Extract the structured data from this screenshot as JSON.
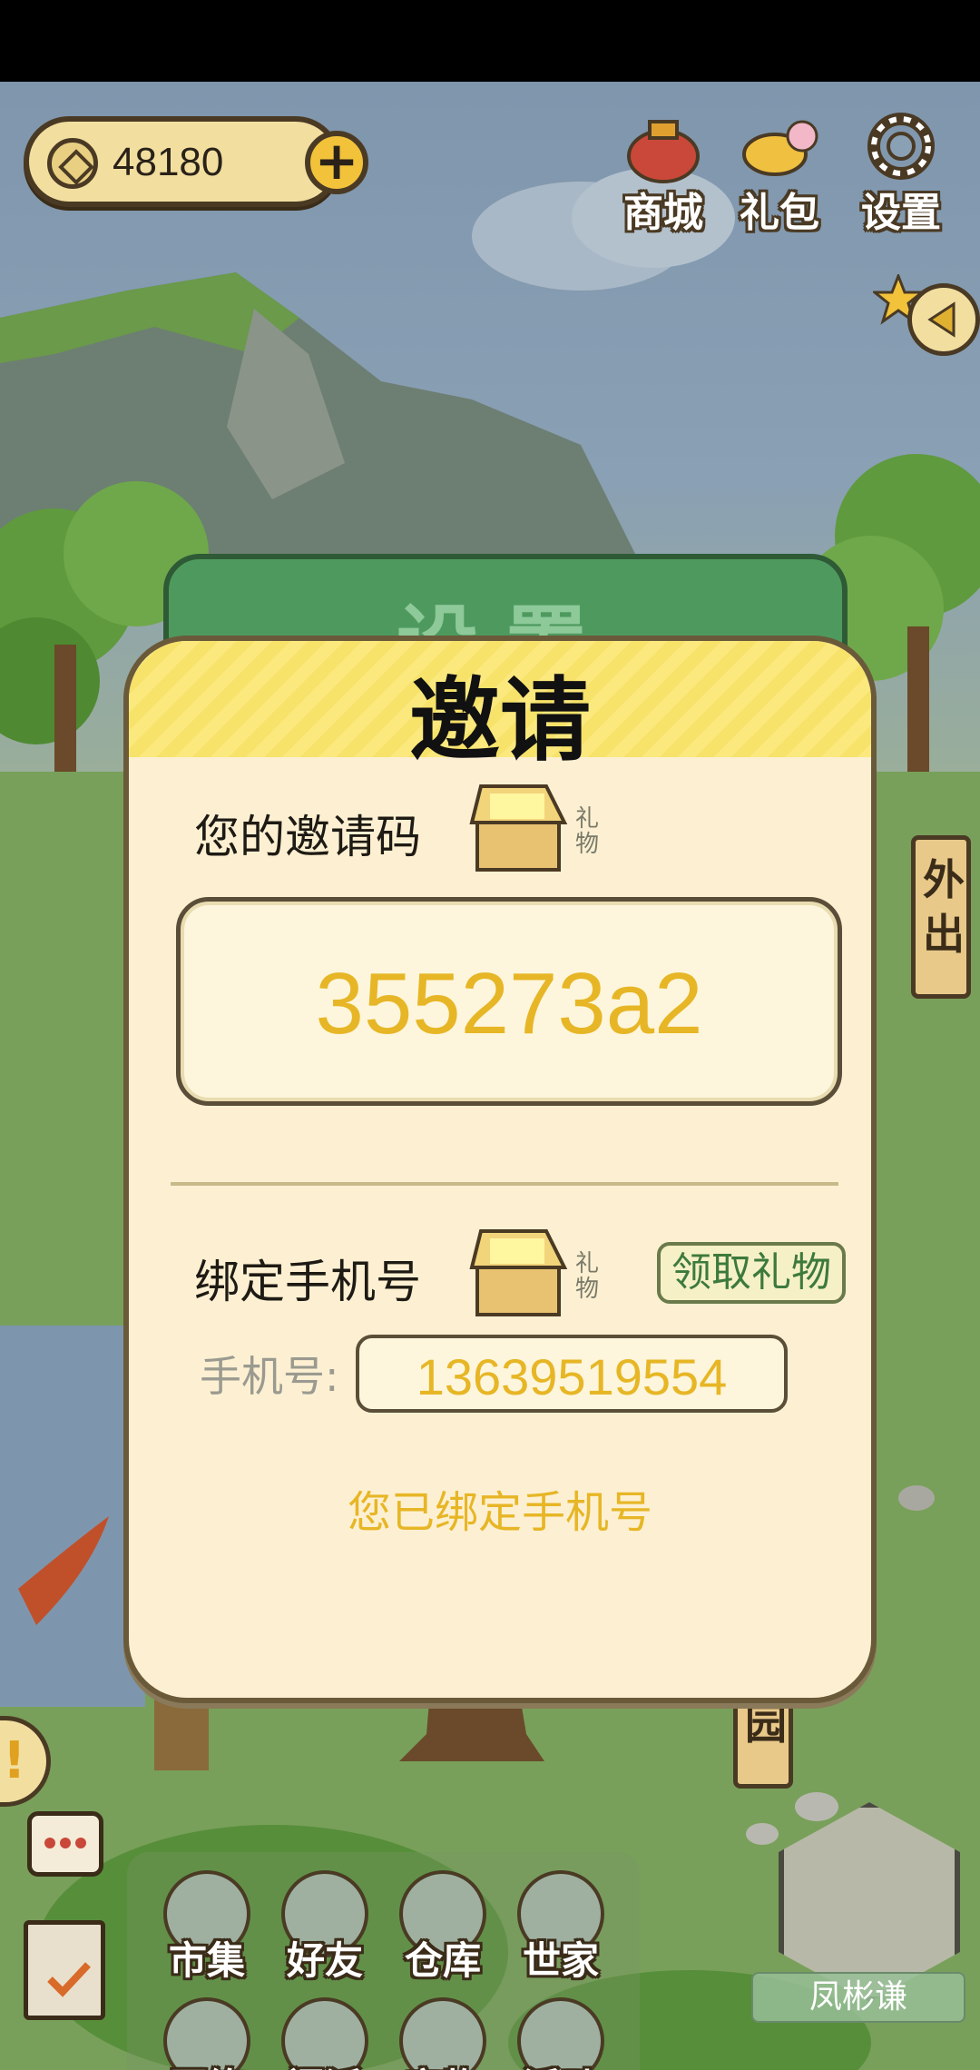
{
  "hud": {
    "coins": "48180",
    "buttons": [
      "商城",
      "礼包",
      "设置"
    ]
  },
  "side_signs": {
    "outing": "外出",
    "garden": "菜园"
  },
  "background_panel": {
    "title": "设置"
  },
  "invite_dialog": {
    "title": "邀请",
    "invite_code_label": "您的邀请码",
    "gift_label": "礼物",
    "invite_code": "355273a2",
    "bind_phone_label": "绑定手机号",
    "claim_gift_button": "领取礼物",
    "phone_field_label": "手机号:",
    "phone_number": "13639519554",
    "bound_status": "您已绑定手机号"
  },
  "bottom_menu": {
    "row1": [
      "市集",
      "好友",
      "仓库",
      "世家"
    ],
    "row2": [
      "历练",
      "门派",
      "宠物",
      "活动"
    ]
  },
  "player": {
    "name": "凤彬谦"
  },
  "colors": {
    "accent_gold": "#e7b626",
    "dialog_bg": "#fdf0d2",
    "header_yellow": "#f7e26a",
    "settings_green": "#4e9a5e"
  }
}
